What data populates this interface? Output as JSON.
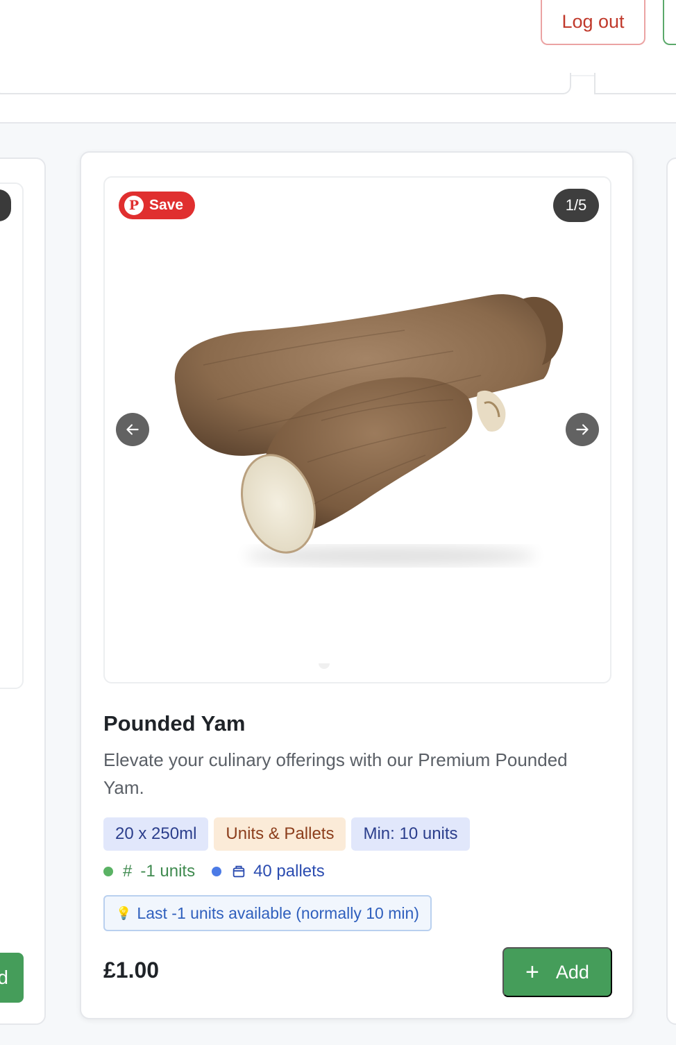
{
  "header": {
    "logout_label": "Log out"
  },
  "left_card": {
    "add_label_partial": "d"
  },
  "product": {
    "save_label": "Save",
    "image_counter": "1/5",
    "title": "Pounded Yam",
    "description": "Elevate your culinary offerings with our Premium Pounded Yam.",
    "tags": [
      "20 x 250ml",
      "Units & Pallets",
      "Min: 10 units"
    ],
    "stock_units": "-1 units",
    "stock_pallets": "40 pallets",
    "notice": "Last -1 units available (normally 10 min)",
    "price": "£1.00",
    "add_label": "Add"
  },
  "icons": {
    "pin": "pinterest-icon",
    "prev": "arrow-left-icon",
    "next": "arrow-right-icon",
    "hash": "hash-icon",
    "pallet": "pallet-icon",
    "bulb": "lightbulb-icon",
    "plus": "plus-icon"
  },
  "colors": {
    "accent_green": "#459d5a",
    "logout_red": "#c0392b",
    "save_red": "#e02f2f",
    "tag_blue_bg": "#e1e7fb",
    "tag_orange_bg": "#fbebd8"
  }
}
